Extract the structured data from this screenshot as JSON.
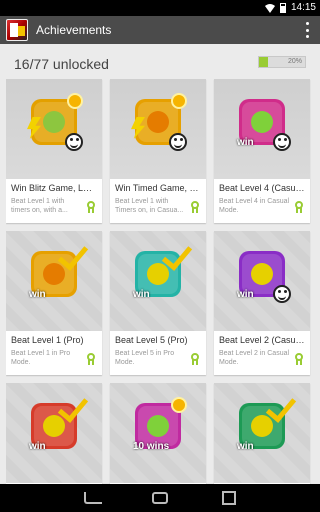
{
  "status": {
    "time": "14:15"
  },
  "app": {
    "title": "Achievements"
  },
  "header": {
    "unlocked_text": "16/77 unlocked",
    "progress_label": "20%",
    "progress_fraction": 0.2
  },
  "colors": {
    "progress_fill": "#99cc33",
    "ribbon": "#99cc33",
    "actionbar": "#4b4b4b"
  },
  "achievements": [
    {
      "title": "Win Blitz Game, Lev...",
      "desc": "Beat Level 1 with timers on, with a...",
      "badge": "#e3a000",
      "accent": "#f3d200",
      "icon": "lightning-badge-icon"
    },
    {
      "title": "Win Timed Game, L...",
      "desc": "Beat Level 1 with Timers on, in Casua...",
      "badge": "#e6a000",
      "accent": "#f6b400",
      "icon": "gold-clock-badge-icon"
    },
    {
      "title": "Beat Level 4 (Casual)",
      "desc": "Beat Level 4 in Casual Mode.",
      "badge": "#d02c8a",
      "accent": "#7fd13a",
      "icon": "win-badge-icon"
    },
    {
      "title": "Beat Level 1 (Pro)",
      "desc": "Beat Level 1 in Pro Mode.",
      "badge": "#e6a000",
      "accent": "#f3d200",
      "icon": "win-check-badge-icon"
    },
    {
      "title": "Beat Level 5 (Pro)",
      "desc": "Beat Level 5 in Pro Mode.",
      "badge": "#24b3a6",
      "accent": "#f3d200",
      "icon": "win-check-badge-icon"
    },
    {
      "title": "Beat Level 2 (Casual)",
      "desc": "Beat Level 2 in Casual Mode.",
      "badge": "#8a2dc6",
      "accent": "#f3d200",
      "icon": "win-badge-icon"
    },
    {
      "title": "",
      "desc": "",
      "badge": "#d63b2a",
      "accent": "#f3d200",
      "icon": "win-check-badge-icon"
    },
    {
      "title": "",
      "desc": "",
      "badge": "#c02aa0",
      "accent": "#f6b400",
      "icon": "ten-wins-badge-icon"
    },
    {
      "title": "",
      "desc": "",
      "badge": "#1d9a55",
      "accent": "#f3d200",
      "icon": "win-check-badge-icon"
    }
  ],
  "badge_text": {
    "win": "win",
    "ten_wins": "10 wins"
  }
}
